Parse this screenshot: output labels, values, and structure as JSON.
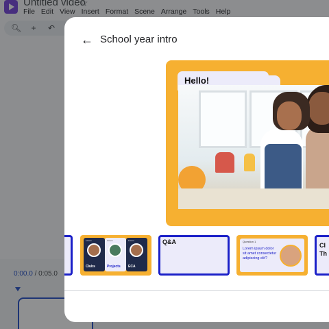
{
  "app": {
    "title": "Untitled video",
    "menu": [
      "File",
      "Edit",
      "View",
      "Insert",
      "Format",
      "Scene",
      "Arrange",
      "Tools",
      "Help"
    ],
    "timecode_current": "0:00.0",
    "timecode_separator": " / ",
    "timecode_total": "0:05.0",
    "accent_color": "#1a47c4",
    "logo_color": "#6f3bd9"
  },
  "dialog": {
    "title": "School year intro",
    "back_icon": "arrow-left-icon",
    "preview": {
      "heading": "Hello!",
      "image_desc_icon": "photo-girl-and-woman"
    },
    "thumbnails": [
      {
        "id": "partial-left"
      },
      {
        "id": "clubs-projects-eca",
        "cards": [
          {
            "kicker": "Lorem",
            "label": "Clubs"
          },
          {
            "kicker": "Lorem",
            "label": "Projects"
          },
          {
            "kicker": "Lorem",
            "label": "ECA"
          }
        ]
      },
      {
        "id": "qa",
        "label": "Q&A"
      },
      {
        "id": "question",
        "kicker": "Question 1",
        "body": "Lorem ipsum dolor sit amet consectetur adipiscing elit?"
      },
      {
        "id": "partial-right",
        "label": "Cl\nTh"
      }
    ],
    "colors": {
      "orange": "#f6b031",
      "blue": "#1b20c8",
      "lavender": "#ecebfa"
    }
  }
}
